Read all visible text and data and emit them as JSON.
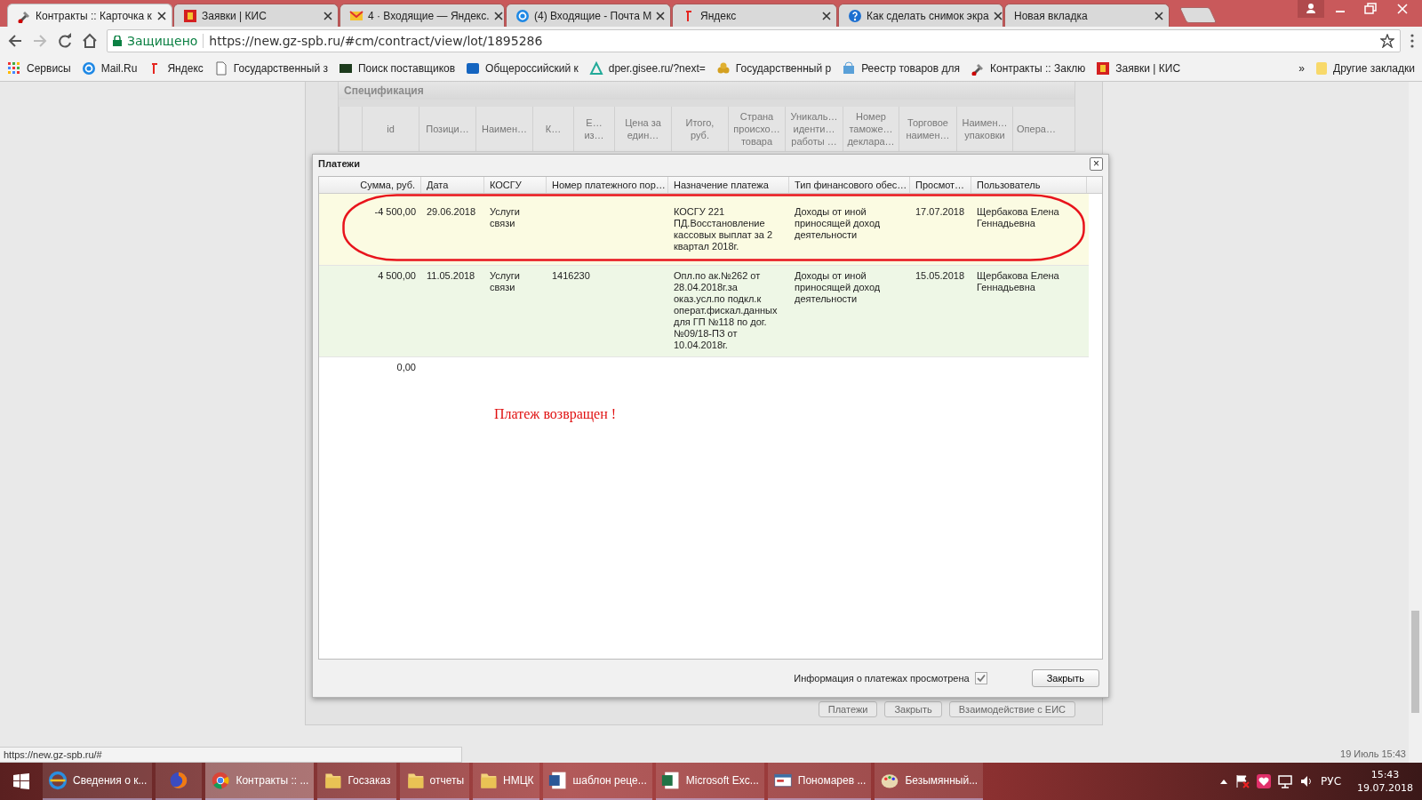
{
  "browser": {
    "tabs": [
      {
        "title": "Контракты :: Карточка к",
        "selected": true
      },
      {
        "title": "Заявки | КИС",
        "selected": false
      },
      {
        "title": "4 · Входящие — Яндекс.",
        "selected": false
      },
      {
        "title": "(4) Входящие - Почта М",
        "selected": false
      },
      {
        "title": "Яндекс",
        "selected": false
      },
      {
        "title": "Как сделать снимок экра",
        "selected": false
      },
      {
        "title": "Новая вкладка",
        "selected": false
      }
    ],
    "security_label": "Защищено",
    "url": "https://new.gz-spb.ru/#cm/contract/view/lot/1895286",
    "bookmarks": [
      "Сервисы",
      "Mail.Ru",
      "Яндекс",
      "Государственный з",
      "Поиск поставщиков",
      "Общероссийский к",
      "dper.gisee.ru/?next=",
      "Государственный р",
      "Реестр товаров для",
      "Контракты :: Заклю",
      "Заявки | КИС"
    ],
    "more_bookmarks": "»",
    "other_bookmarks": "Другие закладки"
  },
  "specification": {
    "title": "Спецификация",
    "columns": [
      "id",
      "Позици…",
      "Наимен…",
      "К…",
      "Е…\nиз…",
      "Цена за\nедин…",
      "Итого,\nруб.",
      "Страна\nпроисхо…\nтовара",
      "Уникаль…\nиденти…\nработы …",
      "Номер\nтаможе…\nдеклара…",
      "Торговое\nнаимен…",
      "Наимен…\nупаковки",
      "Опера…"
    ]
  },
  "background_buttons": [
    "Платежи",
    "Закрыть",
    "Взаимодействие с ЕИС"
  ],
  "dialog": {
    "title": "Платежи",
    "close": "×",
    "columns": [
      "Сумма, руб.",
      "Дата",
      "КОСГУ",
      "Номер платежного пор…",
      "Назначение платежа",
      "Тип финансового обес…",
      "Просмот…",
      "Пользователь"
    ],
    "rows": [
      {
        "color": "#fbfbe2",
        "amount": "-4 500,00",
        "date": "29.06.2018",
        "kosgu": "Услуги связи",
        "purpose": "КОСГУ 221 ПД.Восстановление кассовых выплат за 2 квартал 2018г.",
        "funding_type": "Доходы от иной приносящей доход деятельности",
        "viewed_date": "17.07.2018",
        "user": "Щербакова Елена Геннадьевна"
      },
      {
        "color": "#eef7e6",
        "amount": "4 500,00",
        "date": "11.05.2018",
        "kosgu": "Услуги связи",
        "order_number": "1416230",
        "purpose": "Опл.по ак.№262 от 28.04.2018г.за оказ.усл.по подкл.к операт.фискал.данных для ГП №118 по дог. №09/18-ПЗ от 10.04.2018г.",
        "funding_type": "Доходы от иной приносящей доход деятельности",
        "viewed_date": "15.05.2018",
        "user": "Щербакова Елена Геннадьевна"
      }
    ],
    "total": "0,00",
    "note": "Платеж возвращен !",
    "viewed_label": "Информация о платежах просмотрена",
    "viewed_checked": true,
    "close_button": "Закрыть"
  },
  "status_url": "https://new.gz-spb.ru/#",
  "page_timestamp": "19 Июль 15:43",
  "taskbar": {
    "items": [
      {
        "label": "Сведения о к...",
        "selected": false
      },
      {
        "selected": false
      },
      {
        "label": "Контракты :: ...",
        "selected": true
      },
      {
        "label": "Госзаказ",
        "selected": false
      },
      {
        "label": "отчеты",
        "selected": false
      },
      {
        "label": "НМЦК",
        "selected": false
      },
      {
        "label": "шаблон реце...",
        "selected": false
      },
      {
        "label": "Microsoft Exc...",
        "selected": false
      },
      {
        "label": "Пономарев ...",
        "selected": false
      },
      {
        "label": "Безымянный...",
        "selected": false
      }
    ],
    "language": "РУС",
    "time": "15:43",
    "date": "19.07.2018"
  }
}
